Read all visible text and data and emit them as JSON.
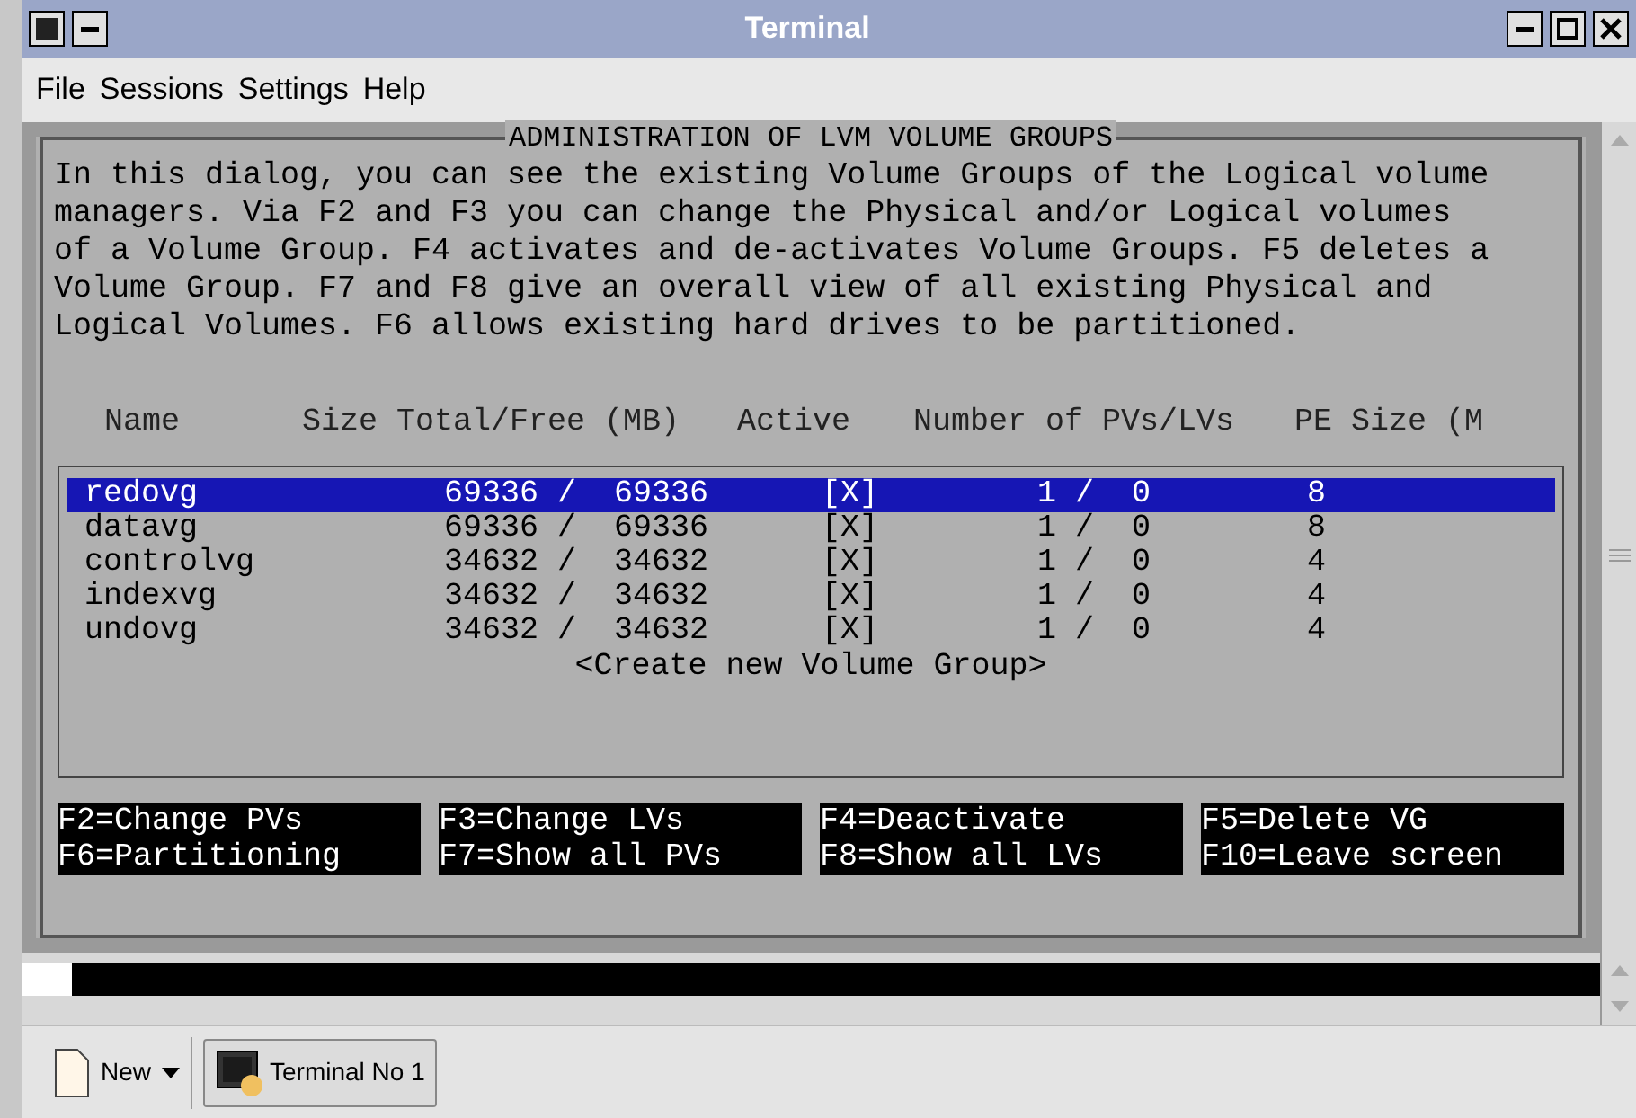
{
  "window": {
    "title": "Terminal"
  },
  "menu": [
    "File",
    "Sessions",
    "Settings",
    "Help"
  ],
  "dialog": {
    "title": "ADMINISTRATION OF LVM VOLUME GROUPS",
    "description": [
      "In this dialog, you can see the existing Volume Groups of the Logical volume",
      "managers. Via F2 and F3 you can change the Physical and/or Logical volumes",
      "of a Volume Group. F4 activates and de-activates Volume Groups. F5 deletes a",
      "Volume Group. F7 and F8 give an overall view of all existing Physical and",
      "Logical Volumes. F6 allows existing hard drives to be partitioned."
    ],
    "columns": [
      "Name",
      "Size Total/Free (MB)",
      "Active",
      "Number of PVs/LVs",
      "PE Size (M"
    ],
    "rows": [
      {
        "name": "redovg",
        "size": "69336 /  69336",
        "active": "[X]",
        "pvs_lvs": "1 /  0",
        "pe_size": "8",
        "selected": true
      },
      {
        "name": "datavg",
        "size": "69336 /  69336",
        "active": "[X]",
        "pvs_lvs": "1 /  0",
        "pe_size": "8",
        "selected": false
      },
      {
        "name": "controlvg",
        "size": "34632 /  34632",
        "active": "[X]",
        "pvs_lvs": "1 /  0",
        "pe_size": "4",
        "selected": false
      },
      {
        "name": "indexvg",
        "size": "34632 /  34632",
        "active": "[X]",
        "pvs_lvs": "1 /  0",
        "pe_size": "4",
        "selected": false
      },
      {
        "name": "undovg",
        "size": "34632 /  34632",
        "active": "[X]",
        "pvs_lvs": "1 /  0",
        "pe_size": "4",
        "selected": false
      }
    ],
    "create_label": "<Create new Volume Group>",
    "function_keys": [
      [
        "F2=Change PVs",
        "F6=Partitioning"
      ],
      [
        "F3=Change LVs",
        "F7=Show all PVs"
      ],
      [
        "F4=Deactivate",
        "F8=Show all LVs"
      ],
      [
        "F5=Delete VG",
        "F10=Leave screen"
      ]
    ]
  },
  "taskbar": {
    "new_label": "New",
    "session_label": "Terminal No 1"
  }
}
